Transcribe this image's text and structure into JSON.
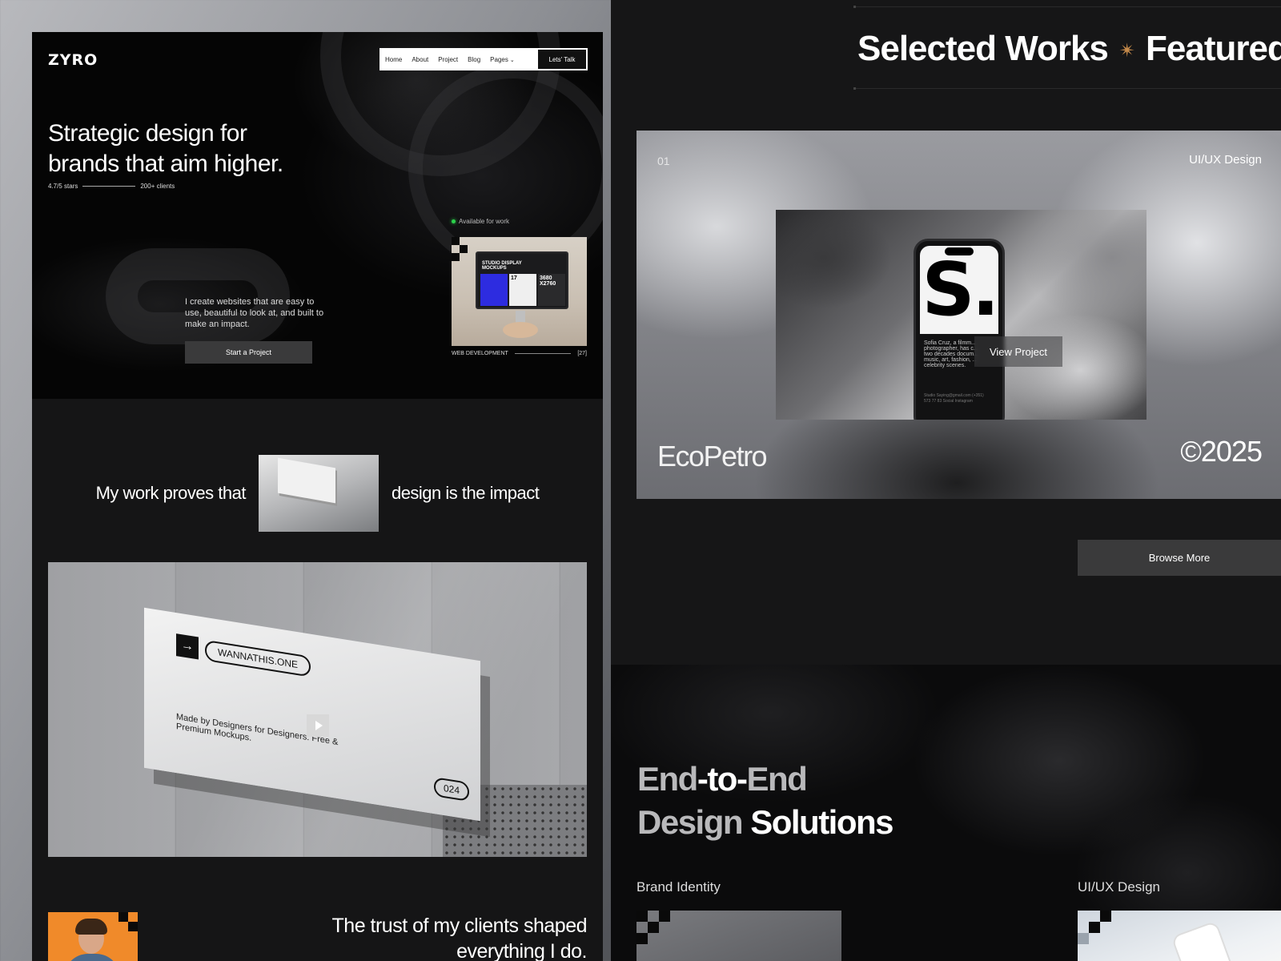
{
  "left": {
    "logo": "ZYRO",
    "nav": {
      "items": [
        "Home",
        "About",
        "Project",
        "Blog"
      ],
      "pages_label": "Pages",
      "cta": "Lets' Talk"
    },
    "hero": {
      "title": "Strategic design for brands that aim higher.",
      "rating": "4.7/5 stars",
      "clients": "200+ clients",
      "description": "I create websites that are easy to use, beautiful to look at, and built to make an impact.",
      "start_button": "Start a Project",
      "availability": "Available for work",
      "promo": {
        "monitor_title": "STUDIO DISPLAY MOCKUPS",
        "tile_number": "17",
        "tile_resolution": "3680 X2760",
        "category": "WEB DEVELOPMENT",
        "count": "[27]"
      }
    },
    "proof": {
      "before": "My work proves that",
      "after": "design is the impact"
    },
    "video": {
      "sign_brand": "WANNATHIS.ONE",
      "sign_tagline": "Made by Designers for Designers. Free & Premium Mockups.",
      "sign_number": "024"
    },
    "trust": "The trust of my clients shaped everything I do."
  },
  "right": {
    "works_title_1": "Selected Works",
    "works_title_2": "Featured P",
    "project": {
      "number": "01",
      "category": "UI/UX Design",
      "phone_letter": "S.",
      "phone_bio": "Sofia Cruz, a filmm... photographer, has c... two decades docum... music, art, fashion, ... celebrity scenes.",
      "phone_meta": "Studio Saying@gmail.com (+351) 573 77 83 Social Instagram",
      "view_button": "View Project",
      "name": "EcoPetro",
      "year": "©2025"
    },
    "browse_button": "Browse More",
    "services": {
      "title_dim_1": "End",
      "title_bright_1": "-to-",
      "title_dim_2": "End",
      "title_dim_3": "Design",
      "title_bright_2": " Solutions",
      "items": [
        "Brand Identity",
        "UI/UX Design"
      ]
    }
  },
  "colors": {
    "accent_star": "#c58a4a",
    "status_green": "#2bd14a",
    "button_dark": "#3a3a3b",
    "panel_bg": "#151516"
  },
  "icons": [
    "chevron-down-icon",
    "star-icon",
    "play-icon",
    "arrow-right-icon"
  ]
}
